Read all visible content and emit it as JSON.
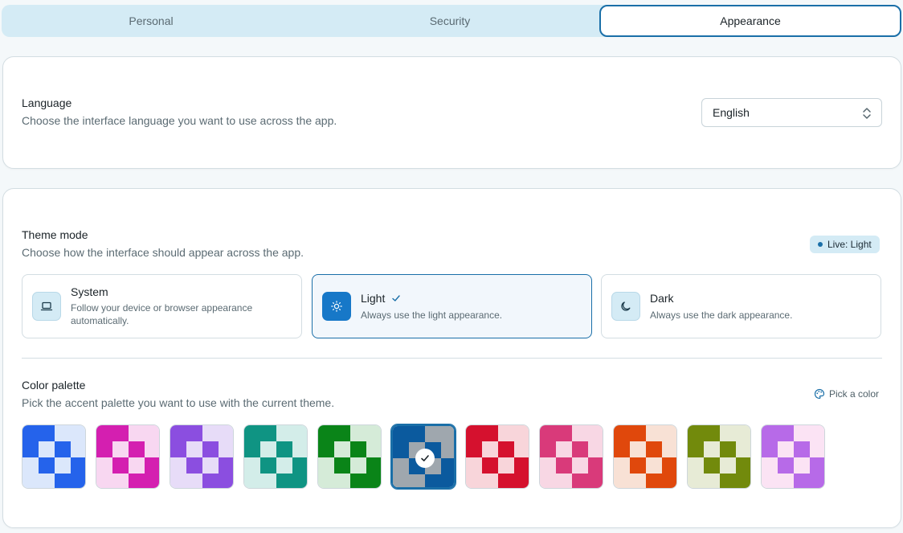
{
  "tabs": [
    {
      "label": "Personal",
      "active": false
    },
    {
      "label": "Security",
      "active": false
    },
    {
      "label": "Appearance",
      "active": true
    }
  ],
  "language": {
    "title": "Language",
    "description": "Choose the interface language you want to use across the app.",
    "selected": "English"
  },
  "theme": {
    "title": "Theme mode",
    "description": "Choose how the interface should appear across the app.",
    "live_badge": "Live: Light",
    "modes": [
      {
        "title": "System",
        "description": "Follow your device or browser appearance automatically.",
        "icon": "laptop-icon",
        "selected": false
      },
      {
        "title": "Light",
        "description": "Always use the light appearance.",
        "icon": "sun-icon",
        "selected": true
      },
      {
        "title": "Dark",
        "description": "Always use the dark appearance.",
        "icon": "moon-icon",
        "selected": false
      }
    ]
  },
  "palette": {
    "title": "Color palette",
    "description": "Pick the accent palette you want to use with the current theme.",
    "pick_label": "Pick a color",
    "selected_index": 5,
    "swatches": [
      {
        "dark": "#2563eb",
        "light": "#dbe7fb"
      },
      {
        "dark": "#d41fb0",
        "light": "#f8d7f1"
      },
      {
        "dark": "#8b4ee0",
        "light": "#e7dcf8"
      },
      {
        "dark": "#0f9483",
        "light": "#d3ede9"
      },
      {
        "dark": "#0a8418",
        "light": "#d5ebd8"
      },
      {
        "dark": "#0b5a9e",
        "light": "#9fa7ae"
      },
      {
        "dark": "#d5112e",
        "light": "#f8d5da"
      },
      {
        "dark": "#d93a7a",
        "light": "#f8d7e4"
      },
      {
        "dark": "#e0480c",
        "light": "#f8e1d5"
      },
      {
        "dark": "#728a0c",
        "light": "#e7ebd6"
      },
      {
        "dark": "#b76ae8",
        "light": "#fbe3f4"
      }
    ]
  }
}
